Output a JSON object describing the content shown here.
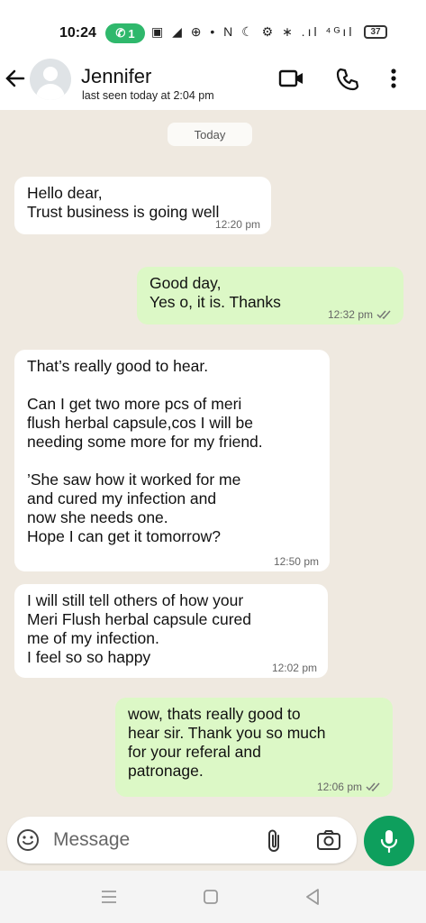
{
  "status_bar": {
    "time": "10:24",
    "pill_count": "1",
    "icons": "▣ ◢ ⊕ •   N ☾ ⚙ ∗ .ıl ⁴ᴳıl",
    "battery": "37"
  },
  "header": {
    "contact_name": "Jennifer",
    "last_seen": "last seen today at 2:04 pm"
  },
  "chat": {
    "date_chip": "Today",
    "messages": [
      {
        "direction": "in",
        "text": "Hello dear,\nTrust business is going well",
        "time": "12:20 pm"
      },
      {
        "direction": "out",
        "text": "Good day,\nYes o, it is. Thanks",
        "time": "12:32 pm"
      },
      {
        "direction": "in",
        "text": "That’s really good to hear.\n\nCan I get two more pcs of meri\nflush herbal capsule,cos I will be\nneeding some more for my friend.\n\n’She saw how it worked for me\nand cured my infection and\nnow she needs one.\nHope I can get it tomorrow?",
        "time": "12:50 pm"
      },
      {
        "direction": "in",
        "text": "I will still tell others of how your\nMeri Flush herbal capsule cured\nme of my infection.\nI feel so so happy",
        "time": "12:02 pm"
      },
      {
        "direction": "out",
        "text": "wow, thats really good to\nhear sir. Thank you so much\nfor your referal and\npatronage.",
        "time": "12:06 pm"
      }
    ]
  },
  "composer": {
    "placeholder": "Message"
  },
  "colors": {
    "incoming_bubble": "#ffffff",
    "outgoing_bubble": "#dcf8c6",
    "chat_background": "#efe9e0",
    "accent_green": "#0e9f5d"
  }
}
